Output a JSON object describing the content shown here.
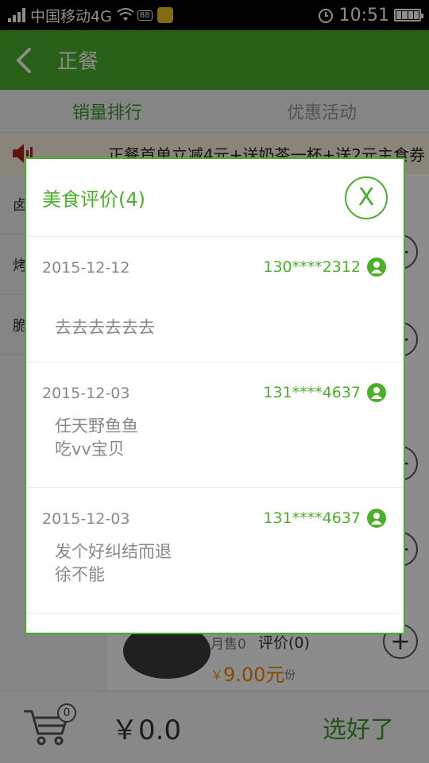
{
  "status_bar": {
    "carrier": "中国移动4G",
    "badge": "88",
    "time": "10:51"
  },
  "header": {
    "title": "正餐"
  },
  "tabs": [
    {
      "label": "销量排行",
      "active": true
    },
    {
      "label": "优惠活动",
      "active": false
    }
  ],
  "promo": {
    "text": "正餐首单立减4元+送奶茶一杯+送2元主食券"
  },
  "categories": [
    "卤",
    "烤",
    "脆"
  ],
  "food_item": {
    "sold": "月售0",
    "review_link": "评价(0)",
    "currency": "￥",
    "price": "9.00元",
    "unit": "份"
  },
  "bottom_bar": {
    "cart_count": "0",
    "total": "￥0.0",
    "done_label": "选好了"
  },
  "dialog": {
    "title": "美食评价(4)",
    "close_label": "X",
    "reviews": [
      {
        "date": "2015-12-12",
        "user": "130****2312",
        "content": "去去去去去去"
      },
      {
        "date": "2015-12-03",
        "user": "131****4637",
        "content": "任天野鱼鱼\n吃vv宝贝"
      },
      {
        "date": "2015-12-03",
        "user": "131****4637",
        "content": "发个好纠结而退\n徐不能"
      }
    ]
  },
  "colors": {
    "brand_green": "#4caf2a",
    "price_orange": "#f08a00",
    "promo_bg": "#fbf3df"
  }
}
